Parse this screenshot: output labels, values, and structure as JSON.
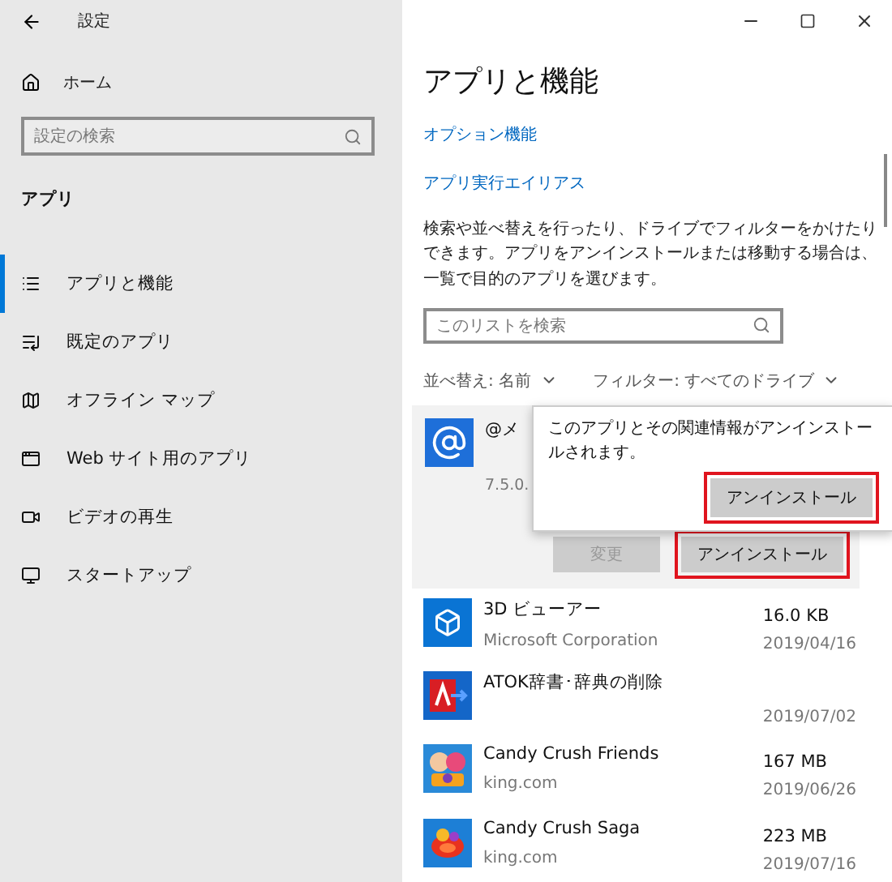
{
  "window": {
    "title": "設定"
  },
  "sidebar": {
    "home": "ホーム",
    "search_placeholder": "設定の検索",
    "section": "アプリ",
    "items": [
      {
        "label": "アプリと機能",
        "selected": true
      },
      {
        "label": "既定のアプリ",
        "selected": false
      },
      {
        "label": "オフライン マップ",
        "selected": false
      },
      {
        "label": "Web サイト用のアプリ",
        "selected": false
      },
      {
        "label": "ビデオの再生",
        "selected": false
      },
      {
        "label": "スタートアップ",
        "selected": false
      }
    ]
  },
  "main": {
    "title": "アプリと機能",
    "links": [
      "オプション機能",
      "アプリ実行エイリアス"
    ],
    "description": "検索や並べ替えを行ったり、ドライブでフィルターをかけたりできます。アプリをアンインストールまたは移動する場合は、一覧で目的のアプリを選びます。",
    "search_placeholder": "このリストを検索",
    "sort": "並べ替え: 名前",
    "filter": "フィルター: すべてのドライブ",
    "expanded_app": {
      "name": "@メ",
      "version": "7.5.0.",
      "buttons": [
        {
          "label": "変更",
          "disabled": true,
          "highlighted": false
        },
        {
          "label": "アンインストール",
          "disabled": false,
          "highlighted": true
        }
      ]
    },
    "popup": {
      "message": "このアプリとその関連情報がアンインストールされます。",
      "button": {
        "label": "アンインストール",
        "highlighted": true
      }
    },
    "apps": [
      {
        "name": "3D ビューアー",
        "publisher": "Microsoft Corporation",
        "size": "16.0 KB",
        "date": "2019/04/16"
      },
      {
        "name": "ATOK辞書･辞典の削除",
        "date": "2019/07/02"
      },
      {
        "name": "Candy Crush Friends",
        "publisher": "king.com",
        "size": "167 MB",
        "date": "2019/06/26"
      },
      {
        "name": "Candy Crush Saga",
        "publisher": "king.com",
        "size": "223 MB",
        "date": "2019/07/16"
      }
    ]
  }
}
